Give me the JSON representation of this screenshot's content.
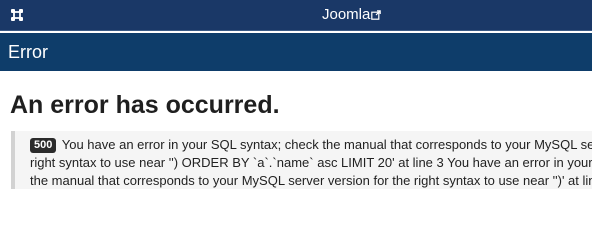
{
  "header": {
    "site_name": "Joomla",
    "logo_icon": "joomla-logo-icon",
    "external_icon": "external-link-icon"
  },
  "titlebar": {
    "title": "Error"
  },
  "main": {
    "heading": "An error has occurred.",
    "error": {
      "code": "500",
      "lines": [
        "You have an error in your SQL syntax; check the manual that corresponds to your MySQL se",
        "right syntax to use near '') ORDER BY `a`.`name` asc LIMIT 20' at line 3 You have an error in your",
        "the manual that corresponds to your MySQL server version for the right syntax to use near '')' at lin"
      ]
    }
  },
  "colors": {
    "topbar": "#1a3867",
    "titlebar": "#0e3d6a",
    "badge": "#2b2b2b"
  }
}
